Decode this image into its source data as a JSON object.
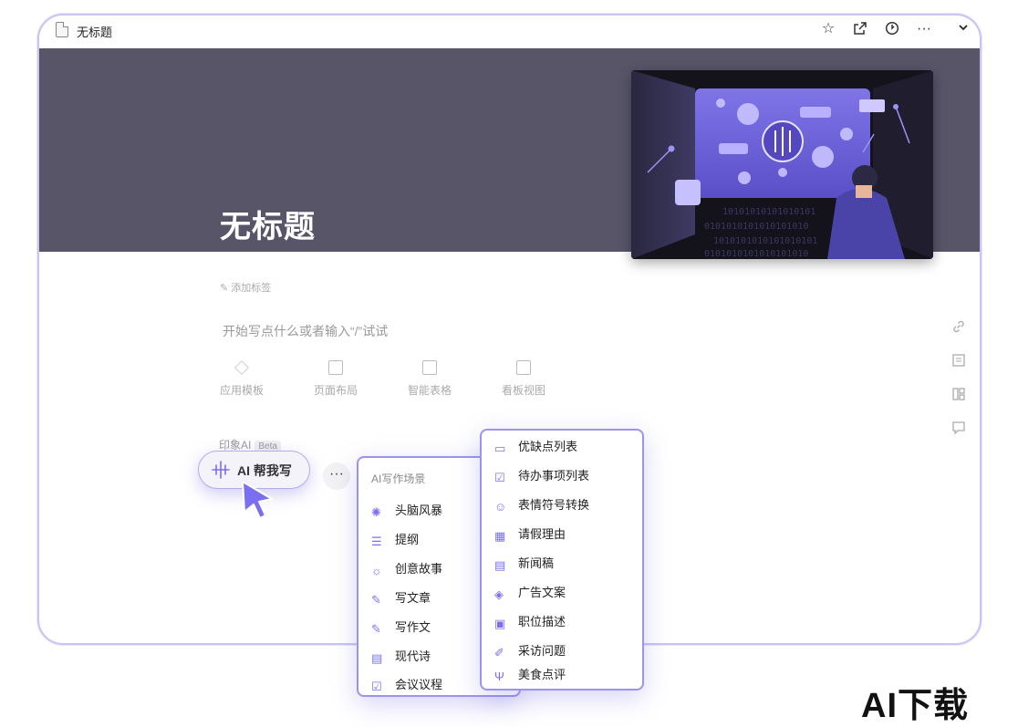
{
  "window": {
    "title": "无标题",
    "toolbar_icons": [
      "star-icon",
      "open-external-icon",
      "history-icon",
      "more-icon",
      "chevron-down-icon"
    ]
  },
  "page": {
    "title": "无标题",
    "add_tag": "添加标签",
    "placeholder": "开始写点什么或者输入“/”试试"
  },
  "tools": [
    {
      "label": "应用模板",
      "icon": "layers-icon"
    },
    {
      "label": "页面布局",
      "icon": "layout-icon"
    },
    {
      "label": "智能表格",
      "icon": "table-icon"
    },
    {
      "label": "看板视图",
      "icon": "kanban-icon"
    }
  ],
  "ai": {
    "section_label": "印象AI",
    "beta": "Beta",
    "button_label": "AI 帮我写",
    "more": "···"
  },
  "scene_menu": {
    "header": "AI写作场景",
    "items": [
      {
        "label": "头脑风暴",
        "icon": "brain-icon"
      },
      {
        "label": "提纲",
        "icon": "list-icon"
      },
      {
        "label": "创意故事",
        "icon": "lightbulb-icon"
      },
      {
        "label": "写文章",
        "icon": "pencil-icon"
      },
      {
        "label": "写作文",
        "icon": "pencil-icon"
      },
      {
        "label": "现代诗",
        "icon": "book-icon"
      },
      {
        "label": "会议议程",
        "icon": "checklist-icon"
      }
    ]
  },
  "sub_menu": {
    "items": [
      {
        "label": "优缺点列表",
        "icon": "list-box-icon"
      },
      {
        "label": "待办事项列表",
        "icon": "todo-icon"
      },
      {
        "label": "表情符号转换",
        "icon": "smile-icon"
      },
      {
        "label": "请假理由",
        "icon": "calendar-icon"
      },
      {
        "label": "新闻稿",
        "icon": "news-icon"
      },
      {
        "label": "广告文案",
        "icon": "cube-icon"
      },
      {
        "label": "职位描述",
        "icon": "document-icon"
      },
      {
        "label": "采访问题",
        "icon": "interview-icon"
      },
      {
        "label": "美食点评",
        "icon": "fork-knife-icon"
      }
    ]
  },
  "watermark": "AI下载",
  "colors": {
    "accent": "#7a6ff0",
    "hero": "#595569",
    "border": "#c9c4f3"
  }
}
